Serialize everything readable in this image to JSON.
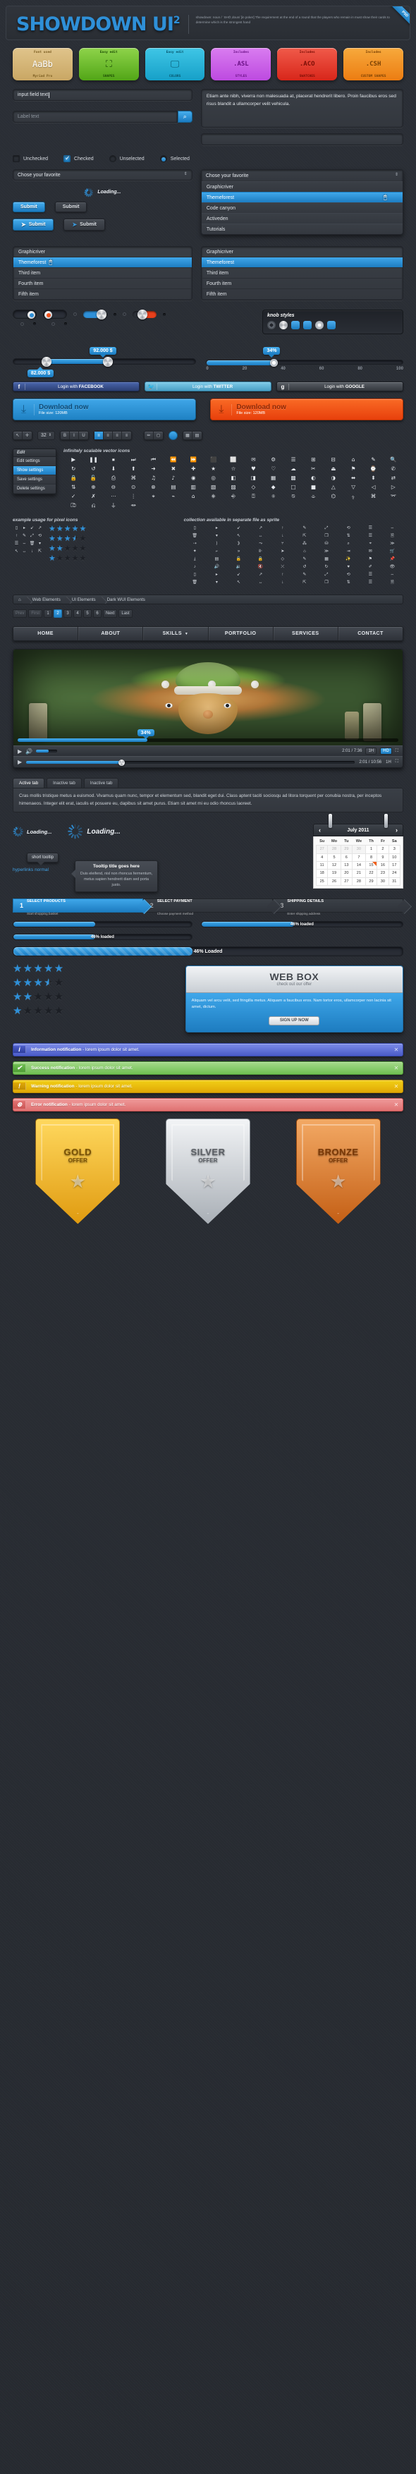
{
  "header": {
    "logo": "SHOWDOWN UI",
    "logo_sup": "2",
    "description": "showdown: noun  / ˈSHŌˌdoun/ [in poker] The requirement at the end of a round that the players who remain in must show their cards to determine which is the strongest hand",
    "ribbon": "PSD"
  },
  "badges": [
    {
      "top": "Font used",
      "mid": "AaBb",
      "bot": "Myriad Pro",
      "theme": "b-gold",
      "icon": "font-icon"
    },
    {
      "top": "Easy edit",
      "mid": "",
      "bot": "SHAPES",
      "theme": "b-green",
      "icon": "transform-handles-icon"
    },
    {
      "top": "Easy edit",
      "mid": "",
      "bot": "COLORS",
      "theme": "b-cyan",
      "icon": "monitor-icon"
    },
    {
      "top": "Includes",
      "mid": ".ASL",
      "bot": "STYLES",
      "theme": "b-purple",
      "icon": "none"
    },
    {
      "top": "Includes",
      "mid": ".ACO",
      "bot": "SWATCHES",
      "theme": "b-red",
      "icon": "none"
    },
    {
      "top": "Includes",
      "mid": ".CSH",
      "bot": "CUSTOM SHAPES",
      "theme": "b-orange",
      "icon": "none"
    }
  ],
  "forms": {
    "input_value": "input field text",
    "textarea_value": "Etiam ante nibh, viverra non malesuada at, placerat hendrerit libero. Proin faucibus eros sed risus blandit a ullamcorper velit vehicula.",
    "label_placeholder": "Label text",
    "search_icon": "search-icon",
    "checkbox_unchecked": "Unchecked",
    "checkbox_checked": "Checked",
    "radio_unselected": "Unselected",
    "radio_selected": "Selected"
  },
  "select": {
    "placeholder": "Chose your favorite",
    "options": [
      "Graphicriver",
      "Themeforest",
      "Code canyon",
      "Activeden",
      "Tutorials"
    ],
    "highlighted": "Themeforest"
  },
  "buttons": {
    "submit": "Submit",
    "plane_icon": "paper-plane-icon",
    "loading": "Loading..."
  },
  "listbox": {
    "items": [
      "Graphicriver",
      "Themeforest",
      "Third item",
      "Fourth item",
      "Fifth item"
    ],
    "selected": "Themeforest"
  },
  "knobs": {
    "title": "knob styles"
  },
  "sliders": {
    "range_low_label": "82.000 $",
    "range_high_label": "92.000 $",
    "percent_label": "34%",
    "ticks": [
      "0",
      "20",
      "40",
      "60",
      "80",
      "100"
    ],
    "range_low_pct": 18,
    "range_high_pct": 52,
    "percent_value": 34
  },
  "social": [
    {
      "glyph": "f",
      "pre": "Login with ",
      "brand": "FACEBOOK",
      "theme": "fb",
      "icon": "facebook-icon"
    },
    {
      "glyph": "🐦",
      "pre": "Login with ",
      "brand": "TWITTER",
      "theme": "tw",
      "icon": "twitter-icon"
    },
    {
      "glyph": "g",
      "pre": "Login with ",
      "brand": "GOOGLE",
      "theme": "gg",
      "icon": "google-icon"
    }
  ],
  "download": {
    "title": "Download now",
    "subtitle": "File size: 120MB",
    "icon": "download-icon"
  },
  "toolbar": {
    "stepper_value": "32",
    "align_icons": [
      "align-left-icon",
      "align-center-icon",
      "align-right-icon",
      "align-justify-icon"
    ],
    "brush_icon": "brush-icon",
    "color_swatch": "#2f90d8"
  },
  "context_menu": {
    "header": "Edit",
    "items": [
      "Edit settings",
      "Show settings",
      "Save settings",
      "Delete settings"
    ],
    "active": "Show settings"
  },
  "icon_sections": {
    "vector_title": "infinitely scalable vector icons",
    "pixel_title": "example usage for pixel icons",
    "sprite_title": "collection available in separate file as sprite"
  },
  "ratings": [
    {
      "filled": 5,
      "half": 0
    },
    {
      "filled": 3,
      "half": 1
    },
    {
      "filled": 2,
      "half": 0
    },
    {
      "filled": 1,
      "half": 0
    }
  ],
  "breadcrumb": {
    "home_icon": "home-icon",
    "items": [
      "Web Elements",
      "UI Elements",
      "Dark WUI Elements"
    ]
  },
  "pagination": {
    "prev": "Prev",
    "first": "First",
    "pages": [
      "1",
      "2",
      "3",
      "4",
      "5",
      "6"
    ],
    "active": "2",
    "next": "Next",
    "last": "Last"
  },
  "navbar": {
    "items": [
      "HOME",
      "ABOUT",
      "SKILLS",
      "PORTFOLIO",
      "SERVICES",
      "CONTACT"
    ],
    "dropdown_on": "SKILLS",
    "chevron_icon": "chevron-down-icon"
  },
  "player": {
    "play_icon": "play-icon",
    "volume_icon": "volume-icon",
    "time": "2:01 / 7:36",
    "time2": "2:01 / 10:56",
    "quality_480": "1H",
    "hd_label": "HD",
    "fullscreen_icon": "fullscreen-icon",
    "progress_label": "34%",
    "progress_pct": 34,
    "progress2_pct": 29
  },
  "tabs": {
    "items": [
      "Active tab",
      "Inactive tab",
      "Inactive tab"
    ],
    "active": "Active tab",
    "body": "Cras mollis tristique metus a euismod. Vivamus quam nunc, tempor et elementum sed, blandit eget dui. Class aptent taciti sociosqu ad litora torquent per conubia nostra, per inceptos himenaeos. Integer elit erat, iaculis et posuere eu, dapibus sit amet purus. Etiam sit amet mi eu odio rhoncus laoreet."
  },
  "loaders": {
    "text": "Loading..."
  },
  "tooltips": {
    "short": "short tooltip",
    "link": "hyperlinks normal",
    "title": "Tooltip title goes here",
    "body": "Duis eleifend, nisl non rhoncus fermentum, metus sapien hendrerit diam sed porta justo."
  },
  "calendar": {
    "month": "July 2011",
    "prev_icon": "chevron-left-icon",
    "next_icon": "chevron-right-icon",
    "weekdays": [
      "Su",
      "Mo",
      "Tu",
      "We",
      "Th",
      "Fr",
      "Sa"
    ],
    "weeks": [
      [
        {
          "d": "27",
          "out": true
        },
        {
          "d": "28",
          "out": true
        },
        {
          "d": "29",
          "out": true
        },
        {
          "d": "30",
          "out": true
        },
        {
          "d": "1"
        },
        {
          "d": "2"
        },
        {
          "d": "3"
        }
      ],
      [
        {
          "d": "4"
        },
        {
          "d": "5"
        },
        {
          "d": "6"
        },
        {
          "d": "7"
        },
        {
          "d": "8"
        },
        {
          "d": "9"
        },
        {
          "d": "10"
        }
      ],
      [
        {
          "d": "11"
        },
        {
          "d": "12"
        },
        {
          "d": "13"
        },
        {
          "d": "14"
        },
        {
          "d": "15",
          "mark": true
        },
        {
          "d": "16"
        },
        {
          "d": "17"
        }
      ],
      [
        {
          "d": "18"
        },
        {
          "d": "19"
        },
        {
          "d": "20"
        },
        {
          "d": "21"
        },
        {
          "d": "22"
        },
        {
          "d": "23"
        },
        {
          "d": "24"
        }
      ],
      [
        {
          "d": "25"
        },
        {
          "d": "26"
        },
        {
          "d": "27"
        },
        {
          "d": "28"
        },
        {
          "d": "29"
        },
        {
          "d": "30"
        },
        {
          "d": "31"
        }
      ]
    ]
  },
  "steps": [
    {
      "n": "1",
      "title": "SELECT PRODUCTS",
      "sub": "Start shopping basket",
      "active": true
    },
    {
      "n": "2",
      "title": "SELECT PAYMENT",
      "sub": "Choose payment method",
      "active": false
    },
    {
      "n": "3",
      "title": "SHIPPING DETAILS",
      "sub": "Enter shipping address",
      "active": false
    }
  ],
  "progress": [
    {
      "label": "46% loaded",
      "value": 46,
      "style": "plain-label-right"
    },
    {
      "label": "46% loaded",
      "value": 46,
      "style": "plain-label-left"
    },
    {
      "label": "46% Loaded",
      "value": 46,
      "style": "striped-big"
    }
  ],
  "webbox": {
    "title": "WEB BOX",
    "subtitle": "check out our offer",
    "body": "Aliquam vel arcu velit, sed fringilla metus. Aliquam a faucibus eros. Nam tortor eros, ullamcorper non lacinia sit amet, dictum.",
    "cta": "SIGN UP NOW"
  },
  "notifications": [
    {
      "theme": "info",
      "glyph": "i",
      "icon": "info-icon",
      "title": "Information notification",
      "rest": " - lorem ipsum dolor sit amet."
    },
    {
      "theme": "succ",
      "glyph": "✔",
      "icon": "check-icon",
      "title": "Success notification",
      "rest": " - lorem ipsum dolor sit amet."
    },
    {
      "theme": "warn",
      "glyph": "!",
      "icon": "warning-icon",
      "title": "Warning notification",
      "rest": " - lorem ipsum dolor sit amet."
    },
    {
      "theme": "err",
      "glyph": "⊗",
      "icon": "error-icon",
      "title": "Error notification",
      "rest": " - lorem ipsum dolor sit amet."
    }
  ],
  "shields": [
    {
      "theme": "sh-gold",
      "a": "GOLD",
      "b": "OFFER",
      "star": "★"
    },
    {
      "theme": "sh-silver",
      "a": "SILVER",
      "b": "OFFER",
      "star": "★"
    },
    {
      "theme": "sh-bronze",
      "a": "BRONZE",
      "b": "OFFER",
      "star": "★"
    }
  ],
  "vector_icons": [
    "▶",
    "❚❚",
    "⏹",
    "⏭",
    "⏮",
    "⏪",
    "⏩",
    "⬛",
    "⬜",
    "✉",
    "⚙",
    "☰",
    "⊞",
    "⊟",
    "⌂",
    "✎",
    "🔍",
    "↻",
    "↺",
    "⬇",
    "⬆",
    "➜",
    "✖",
    "✚",
    "★",
    "☆",
    "♥",
    "♡",
    "☁",
    "✂",
    "⏏",
    "⚑",
    "⌚",
    "✆",
    "🔒",
    "🔓",
    "⎙",
    "⌘",
    "♫",
    "♪",
    "◉",
    "◎",
    "◧",
    "◨",
    "▦",
    "▩",
    "◐",
    "◑",
    "⬌",
    "⬍",
    "⇄",
    "⇅",
    "⊕",
    "⊖",
    "⊙",
    "⊗",
    "▤",
    "▥",
    "▧",
    "▨",
    "◇",
    "◆",
    "□",
    "■",
    "△",
    "▽",
    "◁",
    "▷",
    "✓",
    "✗",
    "⋯",
    "⋮",
    "⌖",
    "⌁",
    "⌂",
    "⎈",
    "⎆",
    "⍰",
    "⍟",
    "⍉",
    "⌯",
    "⌬",
    "⍚",
    "⌘",
    "⌤",
    "⎄",
    "⎌",
    "⏚",
    "⏛"
  ],
  "pixel_icons": [
    "▯",
    "▸",
    "↙",
    "↗",
    "↑",
    "✎",
    "⤢",
    "⟲",
    "☰",
    "⇔",
    "🗑",
    "▾",
    "↖",
    "↔",
    "↓",
    "⇱",
    "❐",
    "⇅",
    "☰",
    "🗎",
    "⇢",
    "⟩",
    "⟫",
    "⤳",
    "⑂",
    "⁂",
    "⛁",
    "⌕",
    "⌖",
    "≫",
    "✦",
    "⌐",
    "»",
    "⊪",
    "➤",
    "⌂",
    "≫",
    "⇥",
    "✉",
    "🛒",
    "⤓",
    "▤",
    "🔓",
    "🔒",
    "◇",
    "✎",
    "▦",
    "✨",
    "⚑",
    "📌",
    "♪",
    "🔊",
    "🔉",
    "🔇",
    "⤫",
    "↺",
    "↻",
    "♥",
    "✐",
    "👁"
  ]
}
